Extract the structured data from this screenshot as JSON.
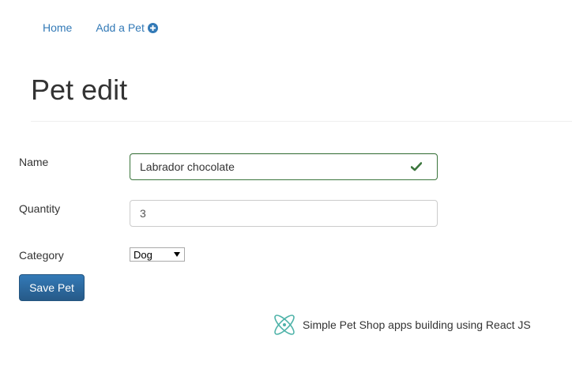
{
  "nav": {
    "home_label": "Home",
    "add_pet_label": "Add a Pet",
    "add_pet_icon": "plus-circle-icon"
  },
  "page": {
    "title": "Pet edit"
  },
  "form": {
    "name": {
      "label": "Name",
      "value": "Labrador chocolate",
      "valid": true,
      "status_icon": "check-icon"
    },
    "quantity": {
      "label": "Quantity",
      "value": "3"
    },
    "category": {
      "label": "Category",
      "selected": "Dog"
    },
    "save_label": "Save Pet"
  },
  "footer": {
    "text": "Simple Pet Shop apps building using React JS",
    "icon": "react-logo-icon"
  },
  "colors": {
    "link": "#337ab7",
    "valid_border": "#3c763d",
    "button_top": "#337ab7",
    "button_bottom": "#265a88",
    "react_logo": "#4fb3a9"
  }
}
